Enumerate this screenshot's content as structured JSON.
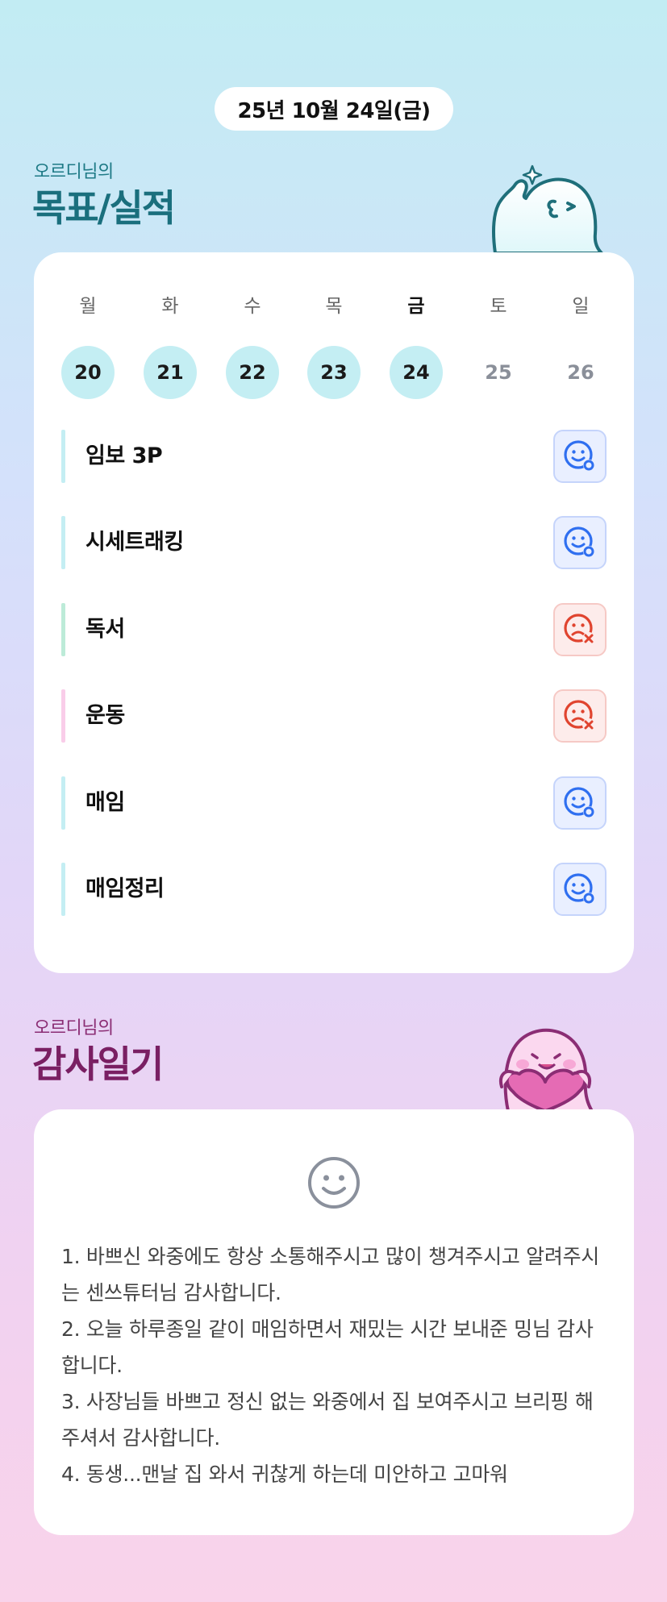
{
  "date": "25년 10월 24일(금)",
  "goals_section": {
    "subtitle": "오르디님의",
    "title": "목표/실적"
  },
  "week": [
    {
      "day": "월",
      "date": "20",
      "state": "done"
    },
    {
      "day": "화",
      "date": "21",
      "state": "done"
    },
    {
      "day": "수",
      "date": "22",
      "state": "done"
    },
    {
      "day": "목",
      "date": "23",
      "state": "done"
    },
    {
      "day": "금",
      "date": "24",
      "state": "today"
    },
    {
      "day": "토",
      "date": "25",
      "state": "future"
    },
    {
      "day": "일",
      "date": "26",
      "state": "future"
    }
  ],
  "goals": [
    {
      "label": "임보 3P",
      "status": "done",
      "status_icon": "smile-check-icon",
      "accent": "#c4eef3"
    },
    {
      "label": "시세트래킹",
      "status": "done",
      "status_icon": "smile-check-icon",
      "accent": "#c4eef3"
    },
    {
      "label": "독서",
      "status": "failed",
      "status_icon": "frown-x-icon",
      "accent": "#bdebd8"
    },
    {
      "label": "운동",
      "status": "failed",
      "status_icon": "frown-x-icon",
      "accent": "#f9cde9"
    },
    {
      "label": "매임",
      "status": "done",
      "status_icon": "smile-check-icon",
      "accent": "#c4eef3"
    },
    {
      "label": "매임정리",
      "status": "done",
      "status_icon": "smile-check-icon",
      "accent": "#c4eef3"
    }
  ],
  "thanks_section": {
    "subtitle": "오르디님의",
    "title": "감사일기",
    "mood_icon": "smile-icon",
    "entries": [
      "1. 바쁘신 와중에도 항상 소통해주시고 많이 챙겨주시고 알려주시는 센쓰튜터님 감사합니다.",
      "2. 오늘 하루종일 같이 매임하면서 재밌는 시간 보내준 밍님 감사합니다.",
      "3. 사장님들 바쁘고 정신 없는 와중에서 집 보여주시고 브리핑 해주셔서 감사합니다.",
      "4. 동생...맨날 집 와서 귀찮게 하는데 미안하고 고마워"
    ]
  },
  "colors": {
    "done_circle": "#c4eef3",
    "ok_icon": "#2f6ff0",
    "fail_icon": "#e0442f",
    "goal_title": "#1a6f7d",
    "thanks_title": "#7a1f63"
  }
}
